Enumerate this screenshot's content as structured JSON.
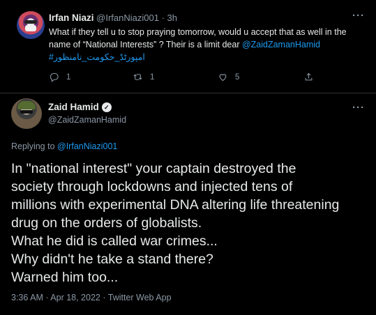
{
  "reply_tweet": {
    "author_name": "Irfan Niazi",
    "author_handle": "@IrfanNiazi001",
    "separator": "·",
    "time": "3h",
    "text_part1": "What if they tell u to stop praying tomorrow, would u accept that as well in the name of “National Interests”  ? Their is a limit dear ",
    "mention": "@ZaidZamanHamid",
    "hashtag": "#امپورٹڈ_حکومت_نامنظور",
    "counts": {
      "replies": "1",
      "retweets": "1",
      "likes": "5"
    },
    "icons": [
      "more-icon",
      "reply-icon",
      "retweet-icon",
      "like-icon",
      "share-icon"
    ]
  },
  "main_tweet": {
    "author_name": "Zaid Hamid",
    "author_handle": "@ZaidZamanHamid",
    "verified_mark": "✓",
    "replying_label": "Replying to ",
    "replying_to": "@IrfanNiazi001",
    "lines": [
      "In \"national interest\" your captain destroyed the",
      "society through lockdowns and injected tens of",
      "millions with experimental DNA altering life threatening",
      "drug on the orders of globalists.",
      "What he did is called war crimes...",
      "Why didn't he take a stand there?",
      "Warned him too..."
    ],
    "meta": "3:36 AM · Apr 18, 2022 · Twitter Web App"
  },
  "colors": {
    "background": "#000000",
    "link": "#1d9bf0",
    "muted": "#8b98a5",
    "text": "#e7e9ea",
    "divider": "#2f3336"
  }
}
